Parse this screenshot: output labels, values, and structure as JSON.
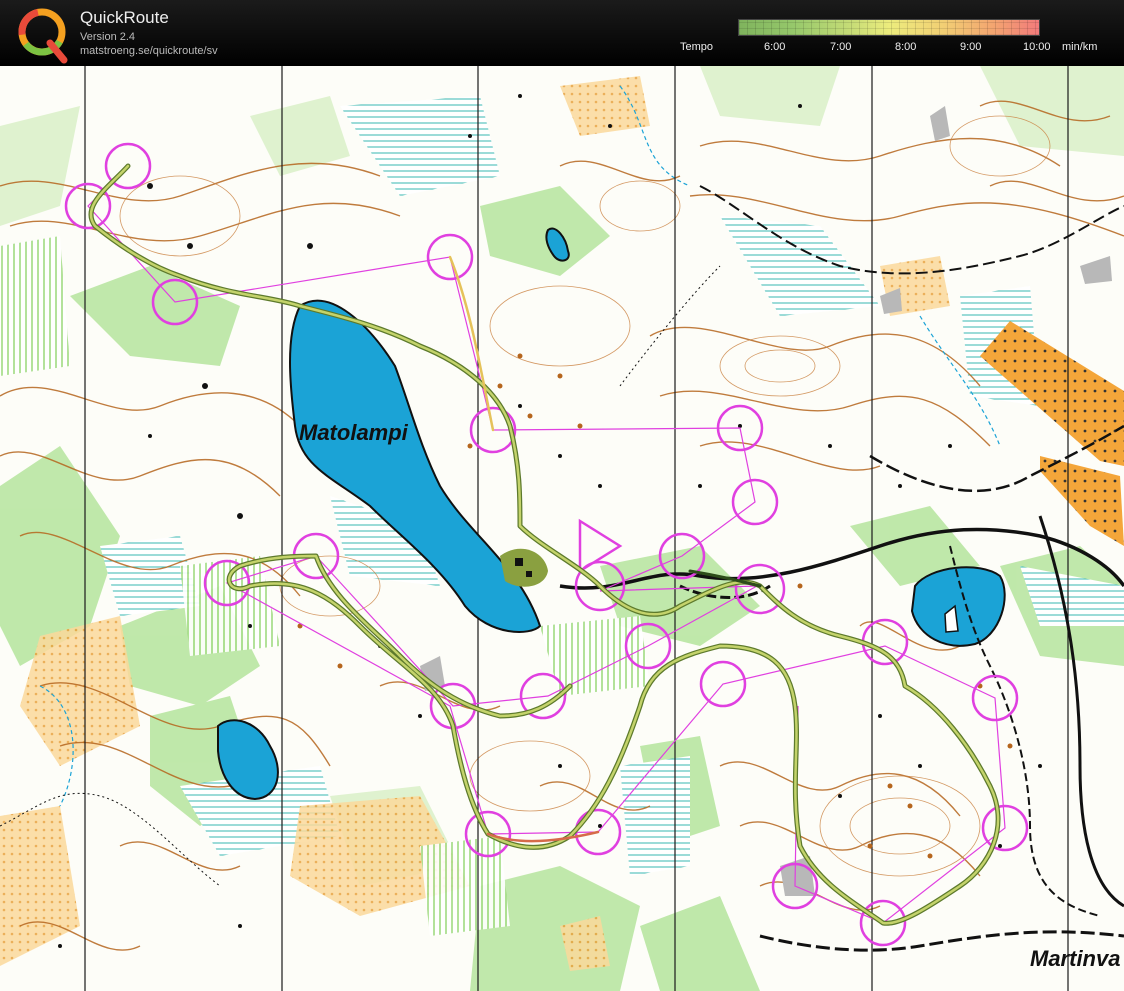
{
  "app": {
    "name": "QuickRoute",
    "version": "Version 2.4",
    "url": "matstroeng.se/quickroute/sv"
  },
  "tempo": {
    "label": "Tempo",
    "ticks": [
      "6:00",
      "7:00",
      "8:00",
      "9:00",
      "10:00"
    ],
    "unit": "min/km",
    "colors": [
      "#7fb35d",
      "#c8dd77",
      "#ecec7d",
      "#f3a470",
      "#f27b7b"
    ]
  },
  "map": {
    "labels": [
      "Matolampi",
      "Martinva"
    ],
    "course_color": "#e040e0",
    "route_color": "#7d9b45",
    "water_color": "#1ba3d6"
  }
}
